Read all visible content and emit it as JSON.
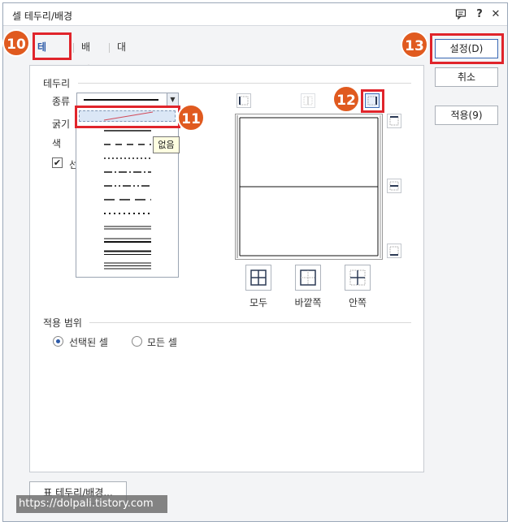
{
  "window": {
    "title": "셀 테두리/배경"
  },
  "titlebar_icons": [
    "comment-icon",
    "help-icon",
    "close-icon"
  ],
  "titlebar_glyphs": {
    "help": "?",
    "close": "✕"
  },
  "tabs": [
    {
      "label": "테두리",
      "active": true
    },
    {
      "label": "배경",
      "active": false
    },
    {
      "label": "대각선",
      "active": false
    }
  ],
  "border_group": {
    "title": "테두리",
    "type_label": "종류",
    "thickness_label": "굵기",
    "color_label": "색",
    "checkbox_label": "선"
  },
  "line_styles": [
    "none",
    "solid",
    "dashed",
    "dotted",
    "dash-dot",
    "dash-dot-dot",
    "long-dash",
    "round-dot",
    "double",
    "thin-thick",
    "thick-thin",
    "triple"
  ],
  "tooltip": "없음",
  "preview_buttons": [
    {
      "label": "모두",
      "icon": "all-borders-icon"
    },
    {
      "label": "바깥쪽",
      "icon": "outer-borders-icon"
    },
    {
      "label": "안쪽",
      "icon": "inner-borders-icon"
    }
  ],
  "apply_group": {
    "title": "적용 범위",
    "options": [
      {
        "label": "선택된 셀",
        "selected": true
      },
      {
        "label": "모든 셀",
        "selected": false
      }
    ]
  },
  "side_buttons": {
    "set": "설정(D)",
    "cancel": "취소",
    "apply": "적용(9)"
  },
  "footer_button": "표 테두리/배경...",
  "watermark": "https://dolpali.tistory.com",
  "badges": [
    "10",
    "11",
    "12",
    "13"
  ],
  "accent_colors": {
    "highlight": "#e0242b",
    "badge": "#e05a1f",
    "tab_active": "#2c5aa8"
  }
}
